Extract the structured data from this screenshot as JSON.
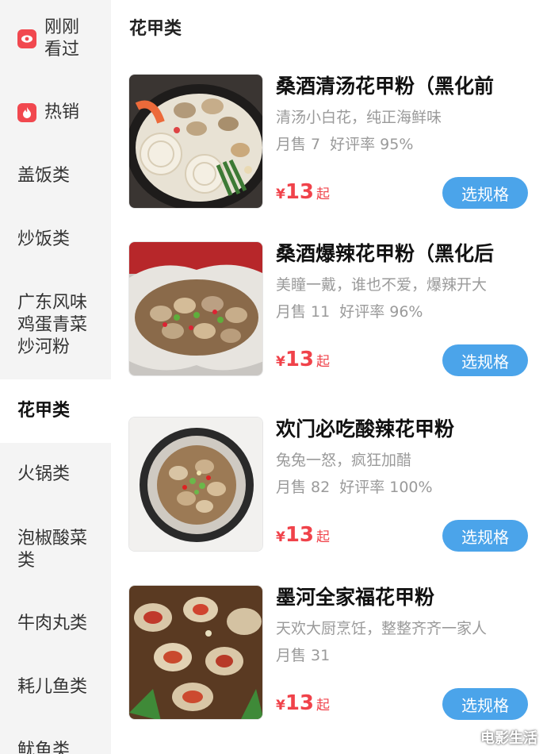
{
  "sidebar": {
    "items": [
      {
        "label": "刚刚\n看过",
        "icon": "eye-icon"
      },
      {
        "label": "热销",
        "icon": "flame-icon"
      },
      {
        "label": "盖饭类"
      },
      {
        "label": "炒饭类"
      },
      {
        "label": "广东风味\n鸡蛋青菜\n炒河粉"
      },
      {
        "label": "花甲类",
        "active": true
      },
      {
        "label": "火锅类"
      },
      {
        "label": "泡椒酸菜\n类"
      },
      {
        "label": "牛肉丸类"
      },
      {
        "label": "耗儿鱼类"
      },
      {
        "label": "鱿鱼类"
      }
    ]
  },
  "section": {
    "title": "花甲类"
  },
  "products": [
    {
      "name": "桑酒清汤花甲粉（黑化前",
      "desc": "清汤小白花，纯正海鲜味",
      "sales": "月售 7",
      "rating": "好评率 95%",
      "currency": "¥",
      "price": "13",
      "price_suffix": "起",
      "button": "选规格",
      "image": "clam-noodle-soup-photo"
    },
    {
      "name": "桑酒爆辣花甲粉（黑化后",
      "desc": "美瞳一戴，谁也不爱，爆辣开大",
      "sales": "月售 11",
      "rating": "好评率 96%",
      "currency": "¥",
      "price": "13",
      "price_suffix": "起",
      "button": "选规格",
      "image": "spicy-clams-foil-photo"
    },
    {
      "name": "欢门必吃酸辣花甲粉",
      "desc": "兔兔一怒，疯狂加醋",
      "sales": "月售 82",
      "rating": "好评率 100%",
      "currency": "¥",
      "price": "13",
      "price_suffix": "起",
      "button": "选规格",
      "image": "sour-spicy-clams-bowl-photo"
    },
    {
      "name": "墨河全家福花甲粉",
      "desc": "天欢大厨烹饪，整整齐齐一家人",
      "sales": "月售 31",
      "rating": "",
      "currency": "¥",
      "price": "13",
      "price_suffix": "起",
      "button": "选规格",
      "image": "family-clam-platter-photo"
    }
  ],
  "watermark": "电影生活",
  "colors": {
    "accent_red": "#f0424a",
    "button_blue": "#4ba4ea",
    "sidebar_bg": "#f4f4f4",
    "icon_red": "#f1484f"
  }
}
